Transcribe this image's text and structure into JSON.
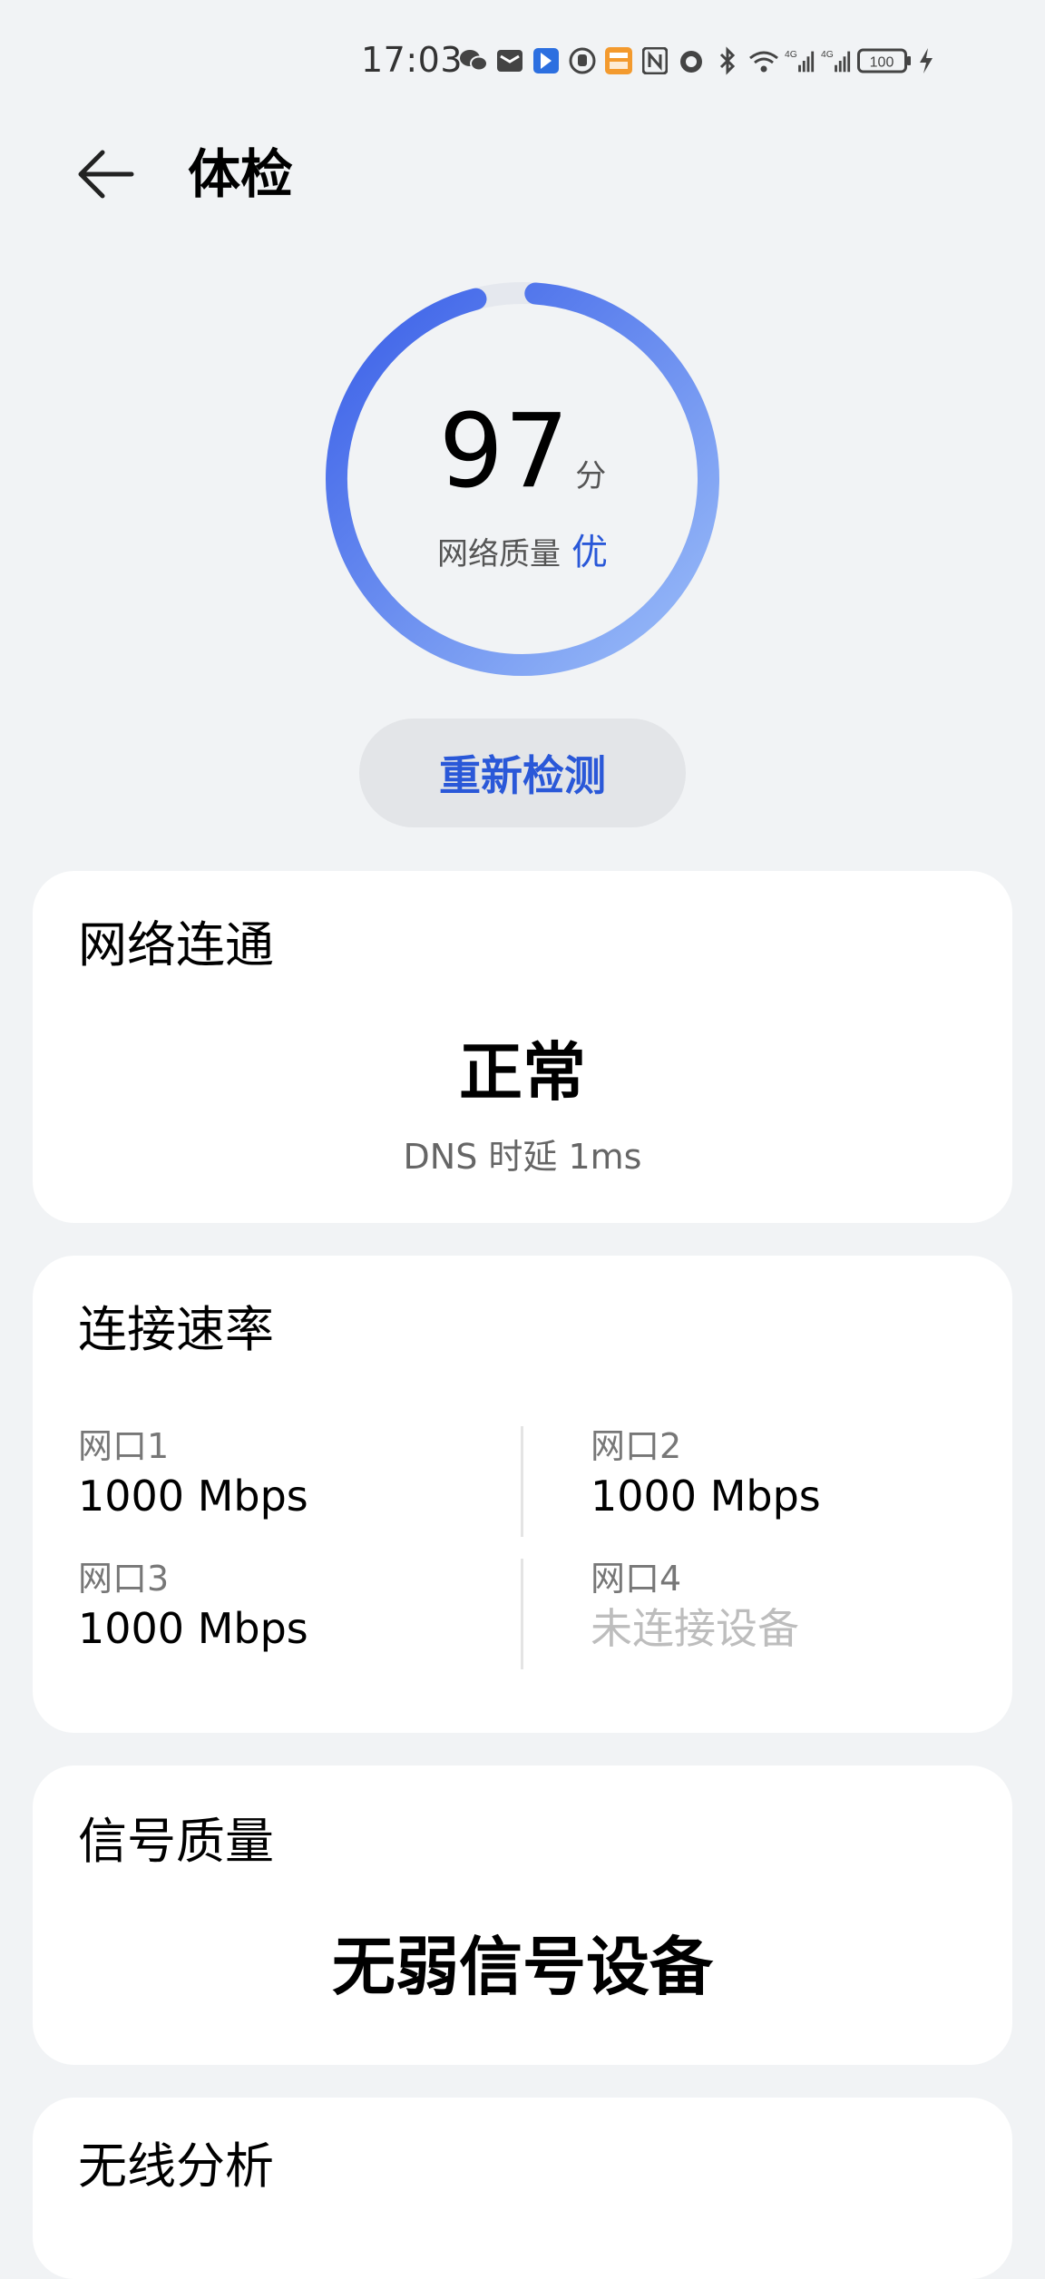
{
  "status_bar": {
    "time": "17:03",
    "icons": [
      "wechat-icon",
      "mail-icon",
      "bookmark-icon",
      "hand-icon",
      "app-badge-icon",
      "nfc-icon",
      "lock-icon",
      "bluetooth-icon",
      "wifi-6-icon",
      "signal-4g-icon",
      "signal-4g-icon",
      "battery-icon",
      "charging-icon"
    ],
    "battery_level": "100"
  },
  "header": {
    "title": "体检"
  },
  "score": {
    "value": "97",
    "unit": "分",
    "fraction": 0.97,
    "quality_label": "网络质量",
    "quality_grade": "优",
    "colors": {
      "arc_start": "#3a5fe8",
      "arc_end": "#9bbdf8",
      "grade": "#2a58d8"
    }
  },
  "retest_button": {
    "label": "重新检测"
  },
  "connectivity": {
    "title": "网络连通",
    "status": "正常",
    "dns_text": "DNS 时延 1ms"
  },
  "link_rate": {
    "title": "连接速率",
    "ports": [
      {
        "label": "网口1",
        "value": "1000 Mbps"
      },
      {
        "label": "网口2",
        "value": "1000 Mbps"
      },
      {
        "label": "网口3",
        "value": "1000 Mbps"
      },
      {
        "label": "网口4",
        "value": "未连接设备"
      }
    ]
  },
  "signal_quality": {
    "title": "信号质量",
    "status": "无弱信号设备"
  },
  "wireless_analysis": {
    "title": "无线分析"
  }
}
